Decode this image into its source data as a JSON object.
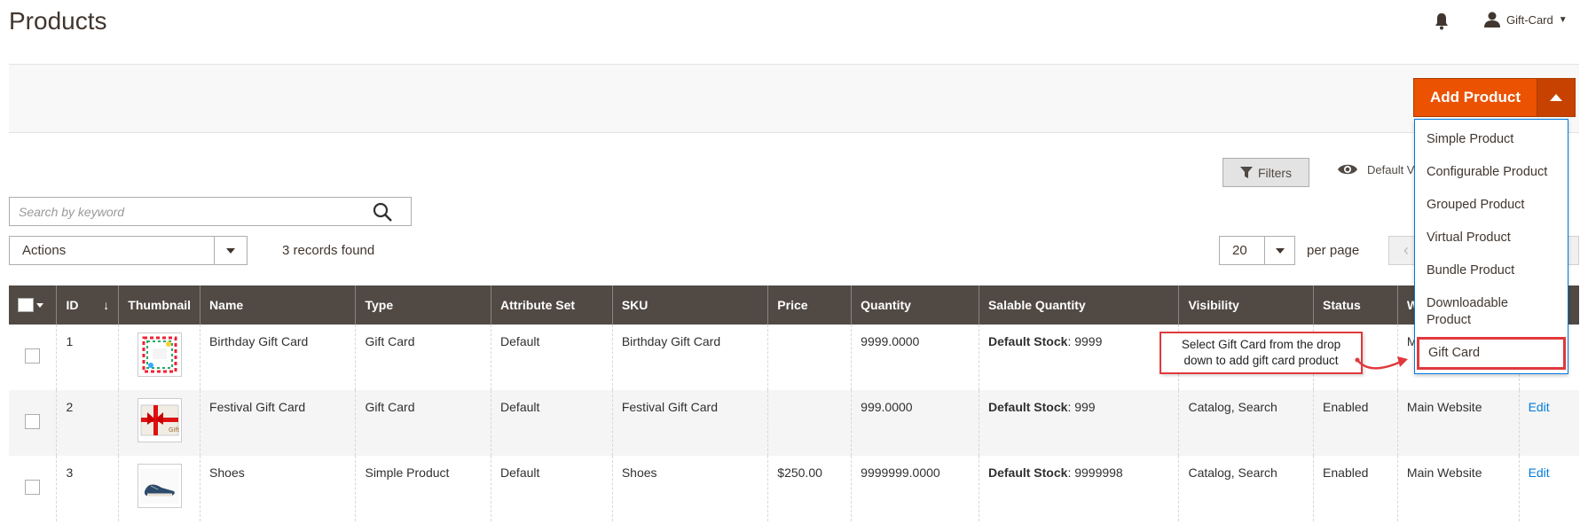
{
  "page_title": "Products",
  "header": {
    "user_name": "Gift-Card"
  },
  "add_product": {
    "label": "Add Product",
    "menu": [
      "Simple Product",
      "Configurable Product",
      "Grouped Product",
      "Virtual Product",
      "Bundle Product",
      "Downloadable Product",
      "Gift Card"
    ],
    "highlighted": "Gift Card"
  },
  "toolbar": {
    "filters_label": "Filters",
    "view_label": "Default V",
    "search_placeholder": "Search by keyword",
    "actions_label": "Actions",
    "records_found": "3 records found",
    "per_page_value": "20",
    "per_page_label": "per page"
  },
  "table": {
    "columns": [
      "ID",
      "Thumbnail",
      "Name",
      "Type",
      "Attribute Set",
      "SKU",
      "Price",
      "Quantity",
      "Salable Quantity",
      "Visibility",
      "Status",
      "W",
      ""
    ],
    "sort_arrow": "↓",
    "rows": [
      {
        "id": "1",
        "name": "Birthday Gift Card",
        "type": "Gift Card",
        "attribute_set": "Default",
        "sku": "Birthday Gift Card",
        "price": "",
        "quantity": "9999.0000",
        "stock_label": "Default Stock",
        "stock_value": ": 9999",
        "visibility": "",
        "status": "nabled",
        "website": "M",
        "action": ""
      },
      {
        "id": "2",
        "name": "Festival Gift Card",
        "type": "Gift Card",
        "attribute_set": "Default",
        "sku": "Festival Gift Card",
        "price": "",
        "quantity": "999.0000",
        "stock_label": "Default Stock",
        "stock_value": ": 999",
        "visibility": "Catalog, Search",
        "status": "Enabled",
        "website": "Main Website",
        "action": "Edit"
      },
      {
        "id": "3",
        "name": "Shoes",
        "type": "Simple Product",
        "attribute_set": "Default",
        "sku": "Shoes",
        "price": "$250.00",
        "quantity": "9999999.0000",
        "stock_label": "Default Stock",
        "stock_value": ": 9999998",
        "visibility": "Catalog, Search",
        "status": "Enabled",
        "website": "Main Website",
        "action": "Edit"
      }
    ]
  },
  "callout": {
    "text": "Select Gift Card from the drop down to add gift card product"
  },
  "colors": {
    "accent": "#eb5202",
    "header_bg": "#514943",
    "link": "#007bdb",
    "callout_border": "#e0393c"
  }
}
